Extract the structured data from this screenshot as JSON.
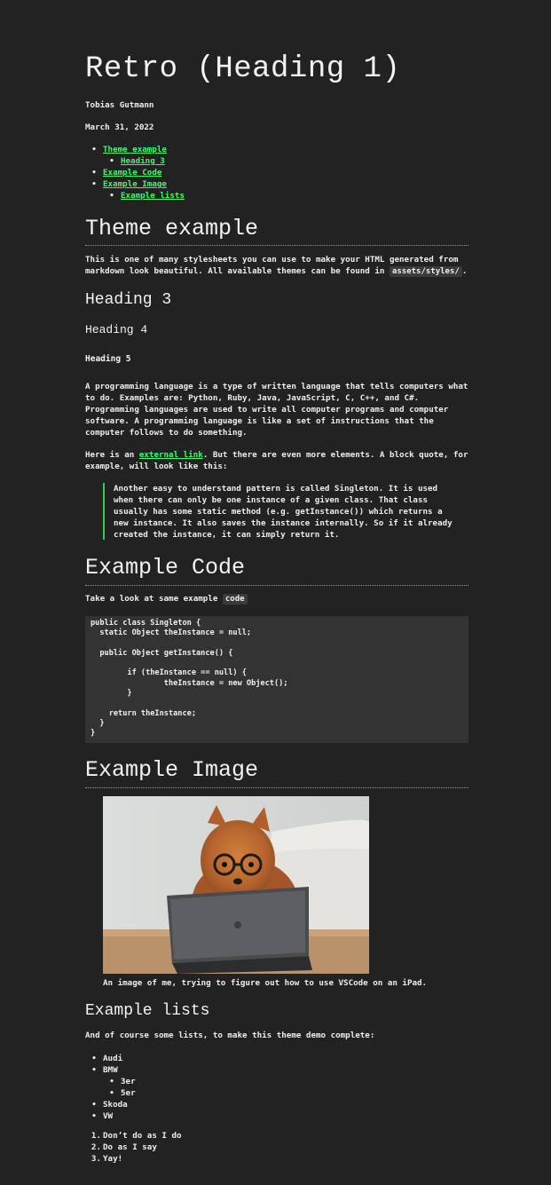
{
  "doc": {
    "title": "Retro (Heading 1)",
    "author": "Tobias Gutmann",
    "date": "March 31, 2022"
  },
  "toc": [
    {
      "label": "Theme example",
      "children": [
        {
          "label": "Heading 3"
        }
      ]
    },
    {
      "label": "Example Code",
      "children": []
    },
    {
      "label": "Example Image",
      "children": [
        {
          "label": "Example lists"
        }
      ]
    }
  ],
  "theme": {
    "heading": "Theme example",
    "intro_before": "This is one of many stylesheets you can use to make your HTML generated from markdown look beautiful. All available themes can be found in ",
    "intro_code": "assets/styles/",
    "intro_after": ".",
    "h3": "Heading 3",
    "h4": "Heading 4",
    "h5": "Heading 5",
    "paragraph": "A programming language is a type of written language that tells computers what to do. Examples are: Python, Ruby, Java, JavaScript, C, C++, and C#. Programming languages are used to write all computer programs and computer software. A programming language is like a set of instructions that the computer follows to do something.",
    "link_before": "Here is an ",
    "link_text": "external link",
    "link_after": ". But there are even more elements. A block quote, for example, will look like this:",
    "quote": "Another easy to understand pattern is called Singleton. It is used when there can only be one instance of a given class. That class usually has some static method (e.g. getInstance()) which returns a new instance. It also saves the instance internally. So if it already created the instance, it can simply return it."
  },
  "code": {
    "heading": "Example Code",
    "intro_before": "Take a look at same example ",
    "intro_code": "code",
    "block": "public class Singleton {\n  static Object theInstance = null;\n\n  public Object getInstance() {\n\n        if (theInstance == null) {\n                theInstance = new Object();\n        }\n\n    return theInstance;\n  }\n}"
  },
  "image": {
    "heading": "Example Image",
    "caption": "An image of me, trying to figure out how to use VSCode on an iPad."
  },
  "lists": {
    "heading": "Example lists",
    "intro": "And of course some lists, to make this theme demo complete:",
    "unordered": [
      {
        "label": "Audi",
        "children": []
      },
      {
        "label": "BMW",
        "children": [
          {
            "label": "3er"
          },
          {
            "label": "5er"
          }
        ]
      },
      {
        "label": "Skoda",
        "children": []
      },
      {
        "label": "VW",
        "children": []
      }
    ],
    "ordered": [
      "Don’t do as I do",
      "Do as I say",
      "Yay!"
    ]
  },
  "colors": {
    "background": "#222222",
    "text": "#e8e8e8",
    "link": "#39ff6a",
    "quote_bar": "#2bd14a",
    "code_bg": "#333333"
  }
}
